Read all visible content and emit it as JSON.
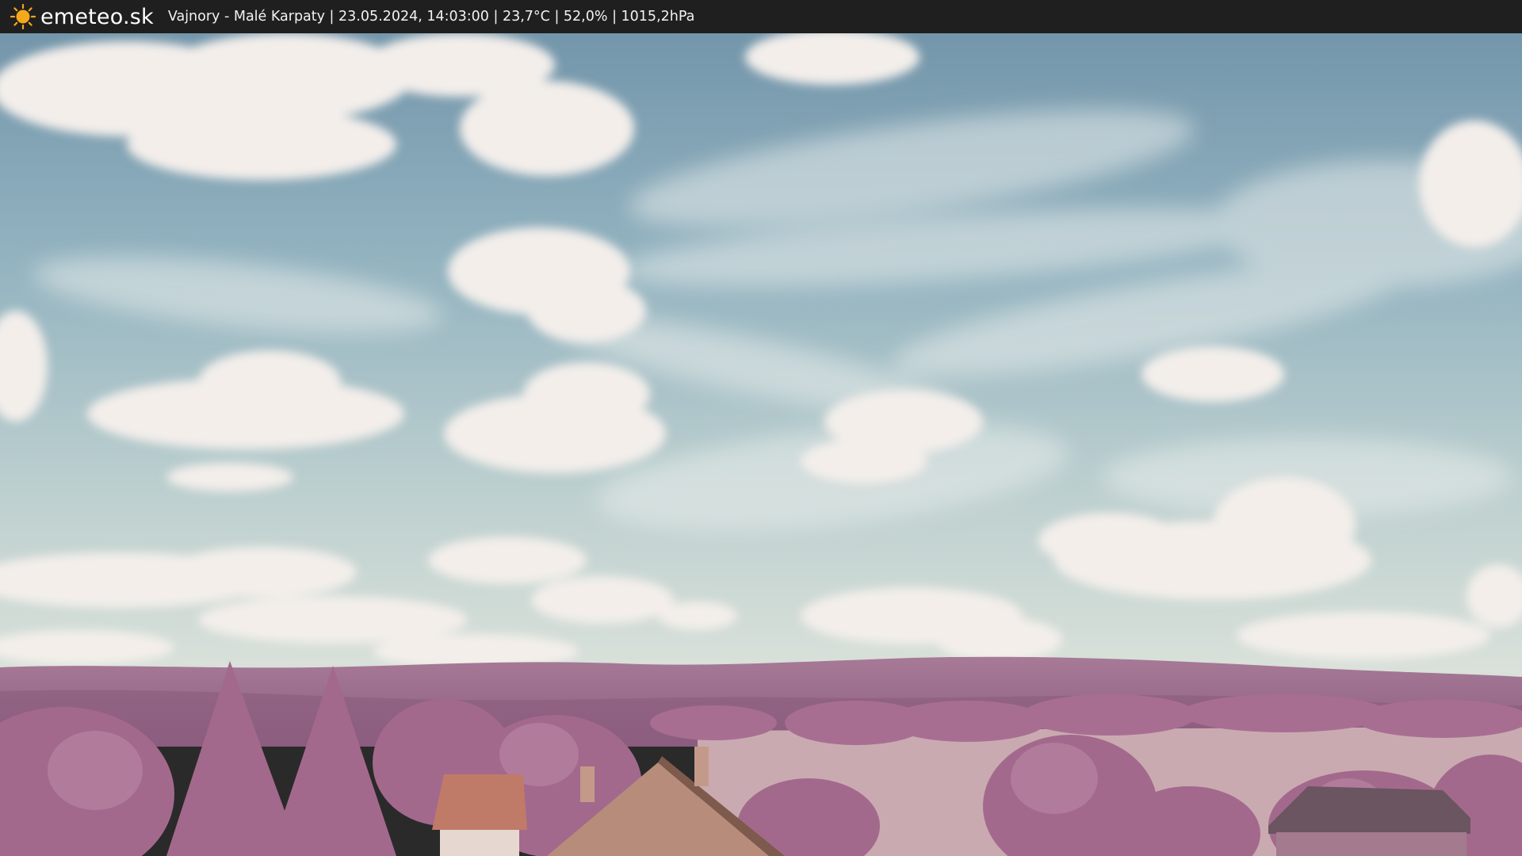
{
  "header": {
    "brand": "emeteo.sk",
    "logo_icon": "sun-icon",
    "info": "Vajnory - Malé Karpaty | 23.05.2024, 14:03:00 | 23,7°C | 52,0% | 1015,2hPa"
  },
  "colors": {
    "bar_background": "#1f1f1f",
    "sun": "#f4a81c",
    "sky_top": "#6f93a8",
    "sky_mid": "#a9c4cc",
    "sky_horizon": "#d8e0d8",
    "cloud": "#f3eeea",
    "hills": "#9c6c8e",
    "foliage": "#a8708f",
    "field": "#c7a8ad",
    "roof": "#b88878"
  }
}
